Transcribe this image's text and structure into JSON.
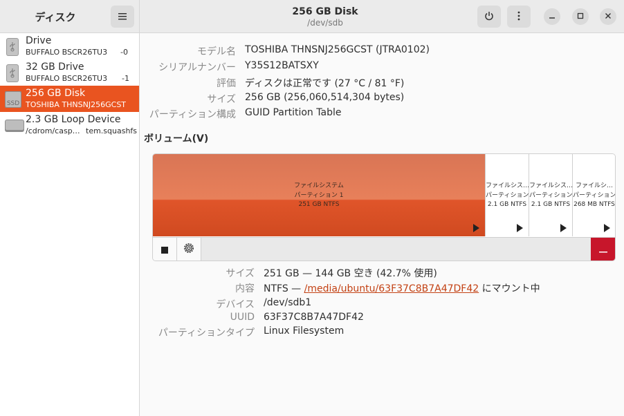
{
  "app": {
    "title": "ディスク"
  },
  "window": {
    "title": "256 GB Disk",
    "subtitle": "/dev/sdb"
  },
  "devices": [
    {
      "name": "Drive",
      "sub": "BUFFALO BSCR26TU3",
      "sub_right": "-0",
      "icon": "usb-drive-icon",
      "selected": false
    },
    {
      "name": "32 GB Drive",
      "sub": "BUFFALO BSCR26TU3",
      "sub_right": "-1",
      "icon": "usb-drive-icon",
      "selected": false
    },
    {
      "name": "256 GB Disk",
      "sub": "TOSHIBA THNSNJ256GCST",
      "sub_right": "",
      "icon": "ssd-icon",
      "icon_text": "SSD",
      "selected": true
    },
    {
      "name": "2.3 GB Loop Device",
      "sub": "/cdrom/casp…",
      "sub_right": "tem.squashfs",
      "icon": "loop-device-icon",
      "selected": false
    }
  ],
  "disk_info": {
    "model_label": "モデル名",
    "model": "TOSHIBA THNSNJ256GCST (JTRA0102)",
    "serial_label": "シリアルナンバー",
    "serial": "Y35S12BATSXY",
    "assessment_label": "評価",
    "assessment": "ディスクは正常です (27 °C / 81 °F)",
    "size_label": "サイズ",
    "size": "256 GB (256,060,514,304 bytes)",
    "partitioning_label": "パーティション構成",
    "partitioning": "GUID Partition Table"
  },
  "volumes": {
    "title": "ボリューム(V)",
    "partitions": [
      {
        "line1": "ファイルシステム",
        "line2": "パーティション 1",
        "line3": "251 GB NTFS"
      },
      {
        "line1": "ファイルシス…",
        "line2": "パーティション…",
        "line3": "2.1 GB NTFS"
      },
      {
        "line1": "ファイルシス…",
        "line2": "パーティション…",
        "line3": "2.1 GB NTFS"
      },
      {
        "line1": "ファイルシ…",
        "line2": "パーティション…",
        "line3": "268 MB NTFS"
      }
    ]
  },
  "volume_info": {
    "size_label": "サイズ",
    "size": "251 GB — 144 GB 空き (42.7% 使用)",
    "contents_label": "内容",
    "contents_prefix": "NTFS —",
    "mount_path": "/media/ubuntu/63F37C8B7A47DF42",
    "contents_suffix": "にマウント中",
    "device_label": "デバイス",
    "device": "/dev/sdb1",
    "uuid_label": "UUID",
    "uuid": "63F37C8B7A47DF42",
    "ptype_label": "パーティションタイプ",
    "ptype": "Linux Filesystem"
  },
  "colors": {
    "accent": "#e95420",
    "danger": "#c7162b",
    "link": "#c34113"
  }
}
